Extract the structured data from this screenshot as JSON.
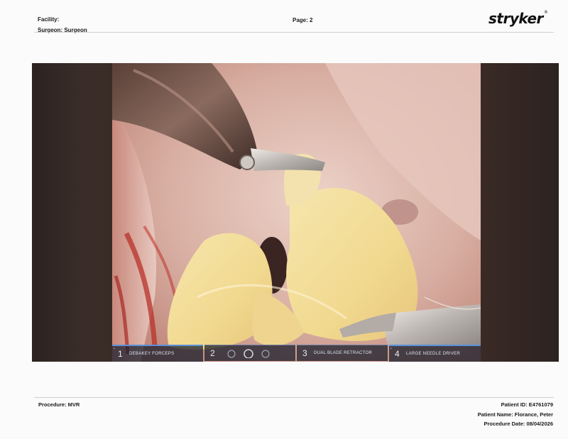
{
  "header": {
    "facility_label": "Facility:",
    "surgeon_label": "Surgeon: Surgeon",
    "page_label": "Page: 2",
    "logo_text": "stryker",
    "logo_mark": "®"
  },
  "image": {
    "hud": {
      "slots": [
        {
          "number": "1",
          "label": "DEBAKEY FORCEPS",
          "active": true
        },
        {
          "number": "2",
          "label": "",
          "active": false
        },
        {
          "number": "3",
          "label": "DUAL BLADE RETRACTOR",
          "active": false
        },
        {
          "number": "4",
          "label": "LARGE NEEDLE DRIVER",
          "active": true
        }
      ],
      "center_caption": "",
      "corner_mark": "•"
    }
  },
  "footer": {
    "procedure": "Procedure: MVR",
    "patient_id": "Patient ID: E4761079",
    "patient_name": "Patient Name: Florance, Peter",
    "procedure_date": "Procedure Date: 08/04/2026"
  },
  "colors": {
    "accent_blue": "#5b8fd6",
    "tissue_pink": "#d9a79a",
    "tissue_yellow": "#f0dc98"
  }
}
